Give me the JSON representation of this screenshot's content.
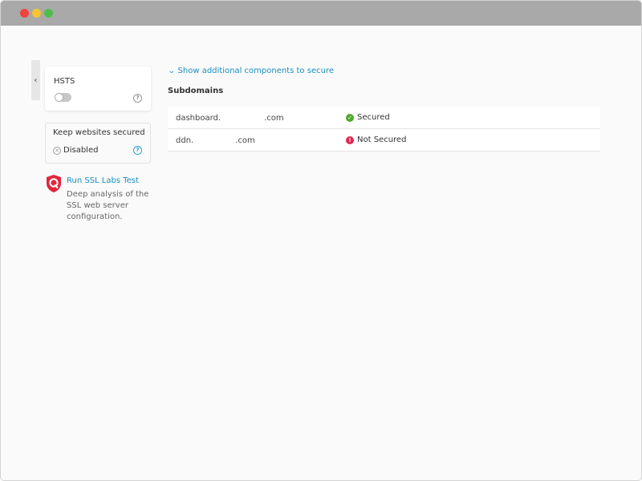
{
  "window": {
    "controls": [
      "close",
      "minimize",
      "maximize"
    ]
  },
  "sidebar": {
    "collapse_glyph": "‹",
    "hsts": {
      "title": "HSTS",
      "toggle_on": false,
      "help_glyph": "?"
    },
    "keep_secured": {
      "title": "Keep websites secured",
      "status": "Disabled",
      "status_icon": "x-circle-icon",
      "help_glyph": "?"
    },
    "ssl_labs": {
      "icon": "qualys-shield-icon",
      "link": "Run SSL Labs Test",
      "description": "Deep analysis of the SSL web server configuration."
    }
  },
  "main": {
    "expand_glyph": "⌄",
    "show_additional": "Show additional components to secure",
    "section_title": "Subdomains",
    "rows": [
      {
        "prefix": "dashboard.",
        "suffix": ".com",
        "status": "Secured",
        "status_glyph": "✓"
      },
      {
        "prefix": "ddn.",
        "suffix": ".com",
        "status": "Not Secured",
        "status_glyph": "!"
      }
    ]
  },
  "colors": {
    "accent": "#1a8ec0",
    "secured": "#52a82d",
    "not_secured": "#e0274f",
    "brand_red": "#e0273e"
  }
}
